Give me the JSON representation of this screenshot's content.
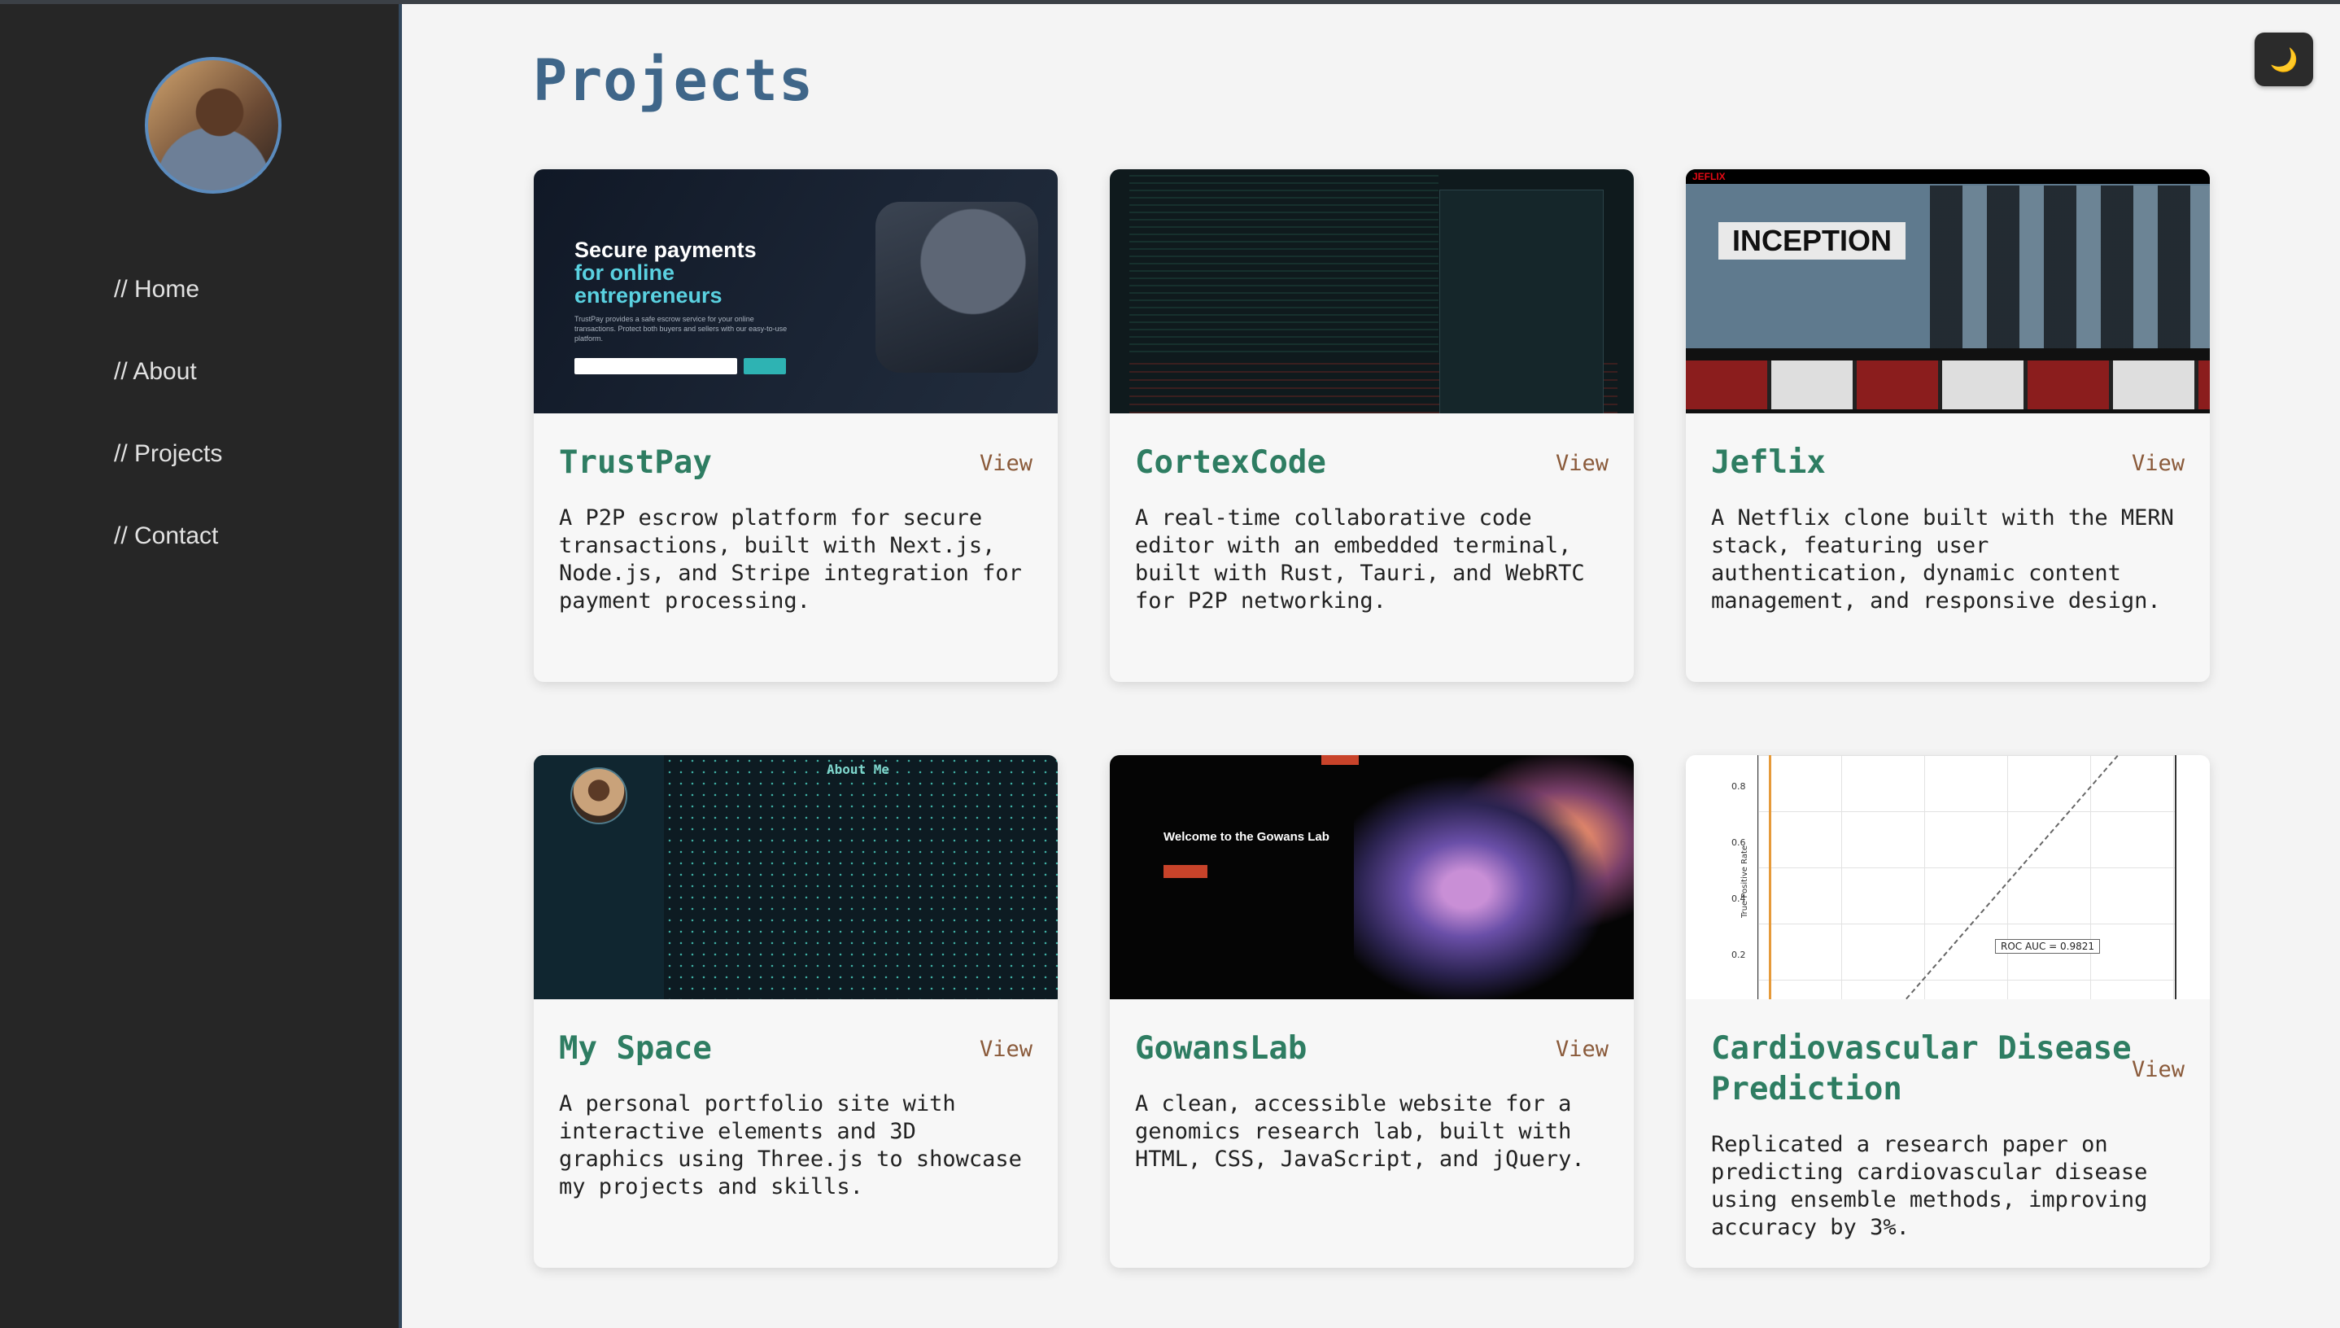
{
  "sidebar": {
    "nav": [
      "// Home",
      "// About",
      "// Projects",
      "// Contact"
    ]
  },
  "theme_toggle": {
    "icon": "moon-icon",
    "glyph": "🌙"
  },
  "page": {
    "title": "Projects"
  },
  "projects": [
    {
      "title": "TrustPay",
      "view": "View",
      "description": "A P2P escrow platform for secure transactions, built with Next.js, Node.js, and Stripe integration for payment processing.",
      "thumb": {
        "headline_1": "Secure payments",
        "headline_2": "for online",
        "headline_3": "entrepreneurs",
        "sub": "TrustPay provides a safe escrow service for your online transactions. Protect both buyers and sellers with our easy-to-use platform."
      }
    },
    {
      "title": "CortexCode",
      "view": "View",
      "description": "A real-time collaborative code editor with an embedded terminal, built with Rust, Tauri, and WebRTC for P2P networking."
    },
    {
      "title": "Jeflix",
      "view": "View",
      "description": "A Netflix clone built with the MERN stack, featuring user authentication, dynamic content management, and responsive design.",
      "thumb": {
        "logo": "JEFLIX",
        "movie": "INCEPTION"
      }
    },
    {
      "title": "My Space",
      "view": "View",
      "description": "A personal portfolio site with interactive elements and 3D graphics using Three.js to showcase my projects and skills.",
      "thumb": {
        "heading": "About Me"
      }
    },
    {
      "title": "GowansLab",
      "view": "View",
      "description": "A clean, accessible website for a genomics research lab, built with HTML, CSS, JavaScript, and jQuery.",
      "thumb": {
        "heading": "Welcome to the Gowans Lab"
      }
    },
    {
      "title": "Cardiovascular Disease Prediction",
      "view": "View",
      "description": "Replicated a research paper on predicting cardiovascular disease using ensemble methods, improving accuracy by 3%.",
      "thumb": {
        "ylabel": "True Positive Rate",
        "ticks": [
          "0.8",
          "0.6",
          "0.4",
          "0.2"
        ],
        "auc": "ROC AUC = 0.9821"
      }
    }
  ],
  "colors": {
    "accent_title": "#3f6689",
    "card_title": "#2e7d62",
    "view_link": "#8a5a3a",
    "sidebar_bg": "#262626"
  }
}
